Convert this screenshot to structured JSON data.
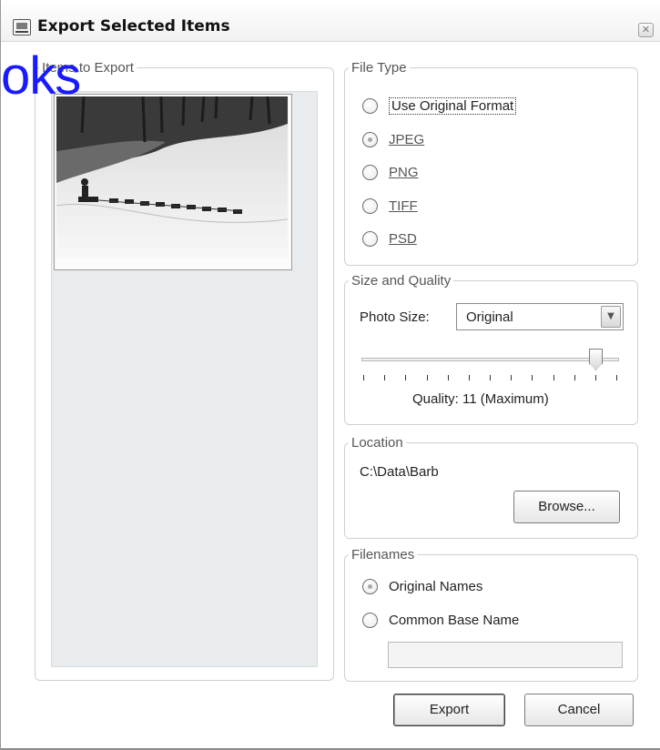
{
  "window": {
    "title": "Export Selected Items",
    "close_symbol": "✕"
  },
  "watermark": {
    "text": "oks"
  },
  "items_to_export": {
    "legend": "Items to Export"
  },
  "file_type": {
    "legend": "File Type",
    "options": [
      {
        "label": "Use Original Format",
        "selected": false
      },
      {
        "label": "JPEG",
        "selected": true
      },
      {
        "label": "PNG",
        "selected": false
      },
      {
        "label": "TIFF",
        "selected": false
      },
      {
        "label": "PSD",
        "selected": false
      }
    ]
  },
  "size_quality": {
    "legend": "Size and Quality",
    "photo_size_label": "Photo Size:",
    "photo_size_value": "Original",
    "quality_label": "Quality: 11 (Maximum)",
    "quality_value": 11,
    "quality_max": 12
  },
  "location": {
    "legend": "Location",
    "path": "C:\\Data\\Barb",
    "browse_label": "Browse..."
  },
  "filenames": {
    "legend": "Filenames",
    "options": [
      {
        "label": "Original Names",
        "selected": true
      },
      {
        "label": "Common Base Name",
        "selected": false
      }
    ],
    "base_name_value": ""
  },
  "actions": {
    "export_label": "Export",
    "cancel_label": "Cancel"
  },
  "colors": {
    "watermark_text": "#1a1aff",
    "group_border": "#d0d0d0"
  },
  "icons": {
    "app": "export-dialog-icon",
    "close": "close-icon",
    "dropdown": "chevron-down-icon"
  }
}
